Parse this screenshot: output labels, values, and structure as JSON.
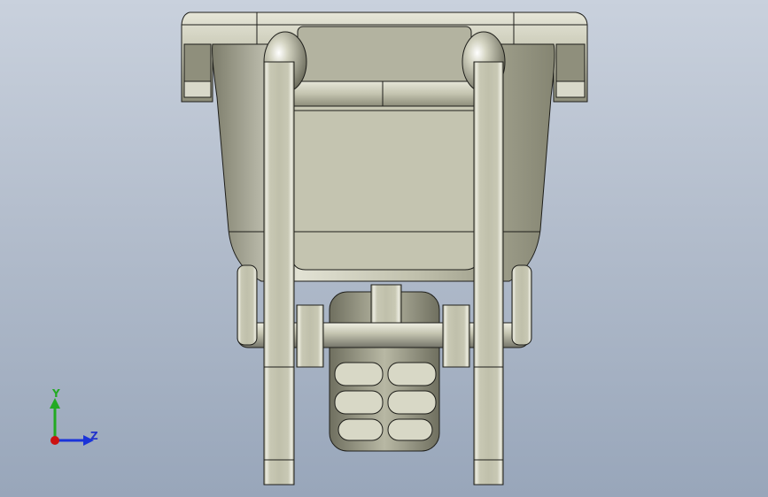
{
  "viewport": {
    "background_top": "#c9d1dd",
    "background_bottom": "#98a6ba"
  },
  "model": {
    "name": "wheelbarrow",
    "view": "front",
    "body_color": "#b9b9a4",
    "shadow_color": "#6f6f5f",
    "highlight_color": "#ecece0",
    "edge_color": "#1e1e1a"
  },
  "triad": {
    "y_label": "Y",
    "z_label": "Z",
    "y_color": "#22aa22",
    "z_color": "#1a33d9",
    "x_color": "#cc1111"
  }
}
